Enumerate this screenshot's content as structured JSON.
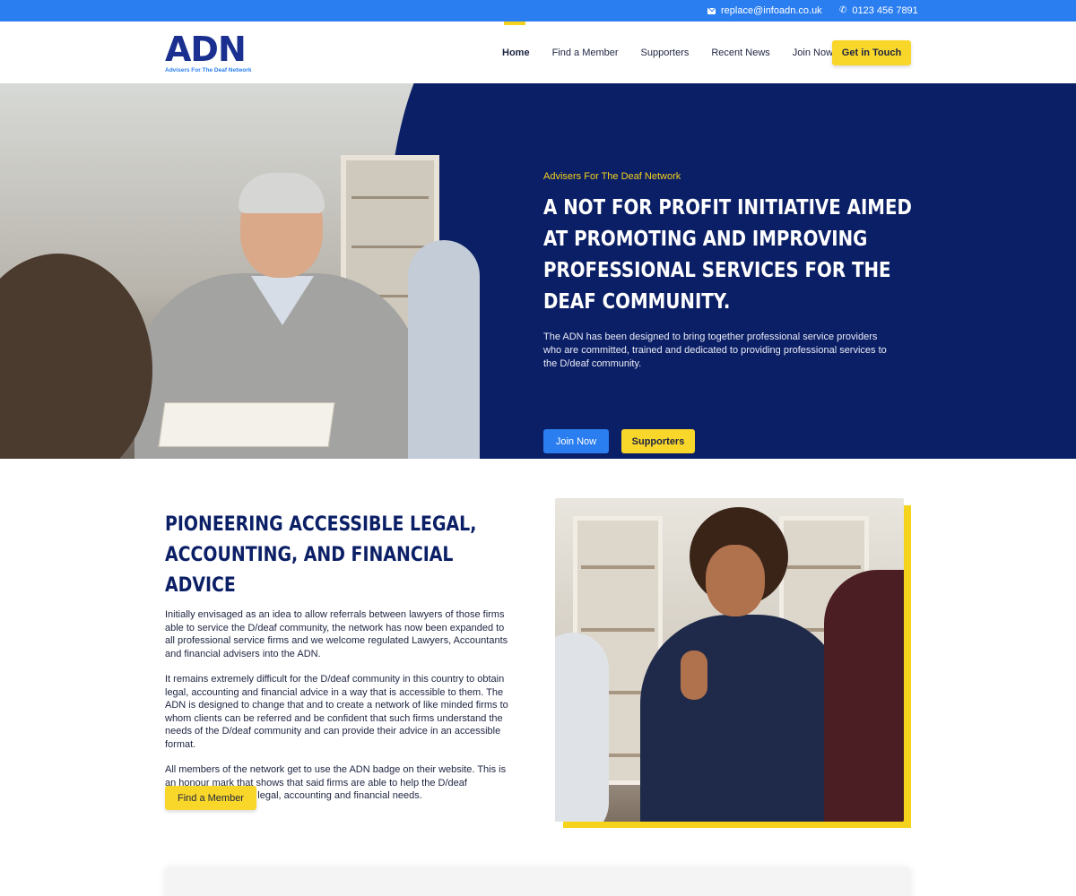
{
  "topbar": {
    "email": "replace@infoadn.co.uk",
    "phone": "0123 456 7891"
  },
  "logo": {
    "letters": "ADN",
    "tagline": "Advisers For The Deaf Network"
  },
  "nav": {
    "items": [
      {
        "label": "Home",
        "active": true
      },
      {
        "label": "Find  a Member"
      },
      {
        "label": "Supporters"
      },
      {
        "label": "Recent News"
      },
      {
        "label": "Join Now"
      }
    ],
    "cta": "Get in Touch"
  },
  "hero": {
    "eyebrow": "Advisers For The Deaf Network",
    "title": "A not for profit initiative aimed at promoting and improving professional services for the deaf community.",
    "description": "The ADN has been designed to bring together professional service providers who are committed, trained and dedicated to providing professional services to the D/deaf community.",
    "join_label": "Join Now",
    "supporters_label": "Supporters"
  },
  "about": {
    "title": "Pioneering accessible legal, accounting, and financial advice",
    "paragraphs": [
      "Initially envisaged as an idea to allow referrals between lawyers of those firms able to service the D/deaf community, the network has now been expanded to all professional service firms and we welcome regulated Lawyers, Accountants and financial advisers into the ADN.",
      "It remains extremely difficult for the D/deaf community in this country to obtain legal, accounting and financial advice in a way that is accessible to them. The ADN is designed to change that and to create a network of like minded firms to whom clients can be referred and be confident that such firms understand the needs of the D/deaf community and can provide their advice in an accessible format.",
      "All members of the network get to use the ADN badge on their website. This is an honour mark that shows that said firms are able to help the D/deaf community with their legal, accounting and financial needs."
    ],
    "button": "Find a Member"
  },
  "colors": {
    "primary_blue": "#2b7ef0",
    "navy": "#0b1f66",
    "yellow": "#f9d62a"
  }
}
